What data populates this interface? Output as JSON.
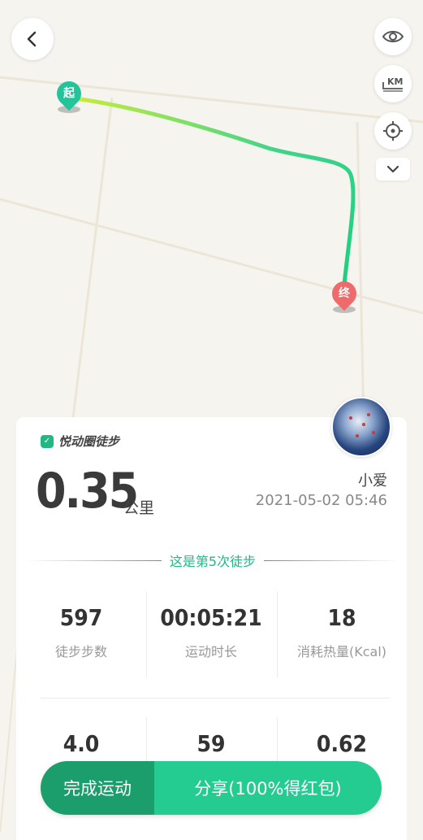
{
  "map": {
    "start_marker": "起",
    "end_marker": "终",
    "controls": {
      "back_icon": "chevron-left-icon",
      "eye_icon": "eye-icon",
      "km_label": "KM",
      "locate_icon": "crosshair-icon",
      "expand_icon": "chevron-down-icon"
    },
    "track_colors": {
      "start": "#c6ec3c",
      "end": "#1ccf7f"
    }
  },
  "card": {
    "brand": "悦动圈徒步",
    "distance": "0.35",
    "distance_unit": "公里",
    "user_name": "小爱",
    "datetime": "2021-05-02 05:46",
    "session_text": "这是第5次徒步",
    "stats_row1": [
      {
        "value": "597",
        "label": "徒步步数"
      },
      {
        "value": "00:05:21",
        "label": "运动时长"
      },
      {
        "value": "18",
        "label": "消耗热量(Kcal)"
      }
    ],
    "stats_row2": [
      {
        "value": "4.0"
      },
      {
        "value": "59"
      },
      {
        "value": "0.62"
      }
    ]
  },
  "actions": {
    "finish_label": "完成运动",
    "share_label": "分享(100%得红包)"
  },
  "colors": {
    "accent": "#22b884",
    "finish_button": "#1b9d6c",
    "share_button": "#25cc92",
    "end_marker": "#ef6a6a"
  }
}
